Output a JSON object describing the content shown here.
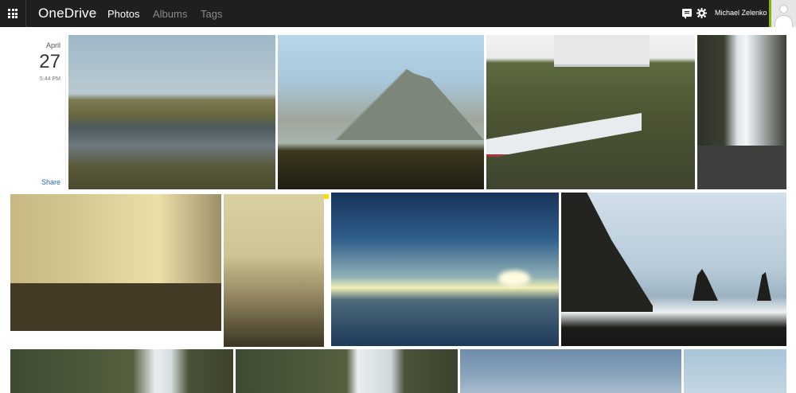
{
  "app": {
    "brand": "OneDrive",
    "nav": [
      {
        "label": "Photos",
        "active": true
      },
      {
        "label": "Albums",
        "active": false
      },
      {
        "label": "Tags",
        "active": false
      }
    ],
    "user_name": "Michael Zelenko",
    "icons": [
      "app-launcher-icon",
      "feedback-icon",
      "gear-icon",
      "avatar"
    ]
  },
  "date_group": {
    "month": "April",
    "day": "27",
    "time": "5:44 PM",
    "share_label": "Share"
  },
  "colors": {
    "topbar": "#1f1f1f",
    "accent_avatar": "#7fba00",
    "link": "#2266aa"
  }
}
